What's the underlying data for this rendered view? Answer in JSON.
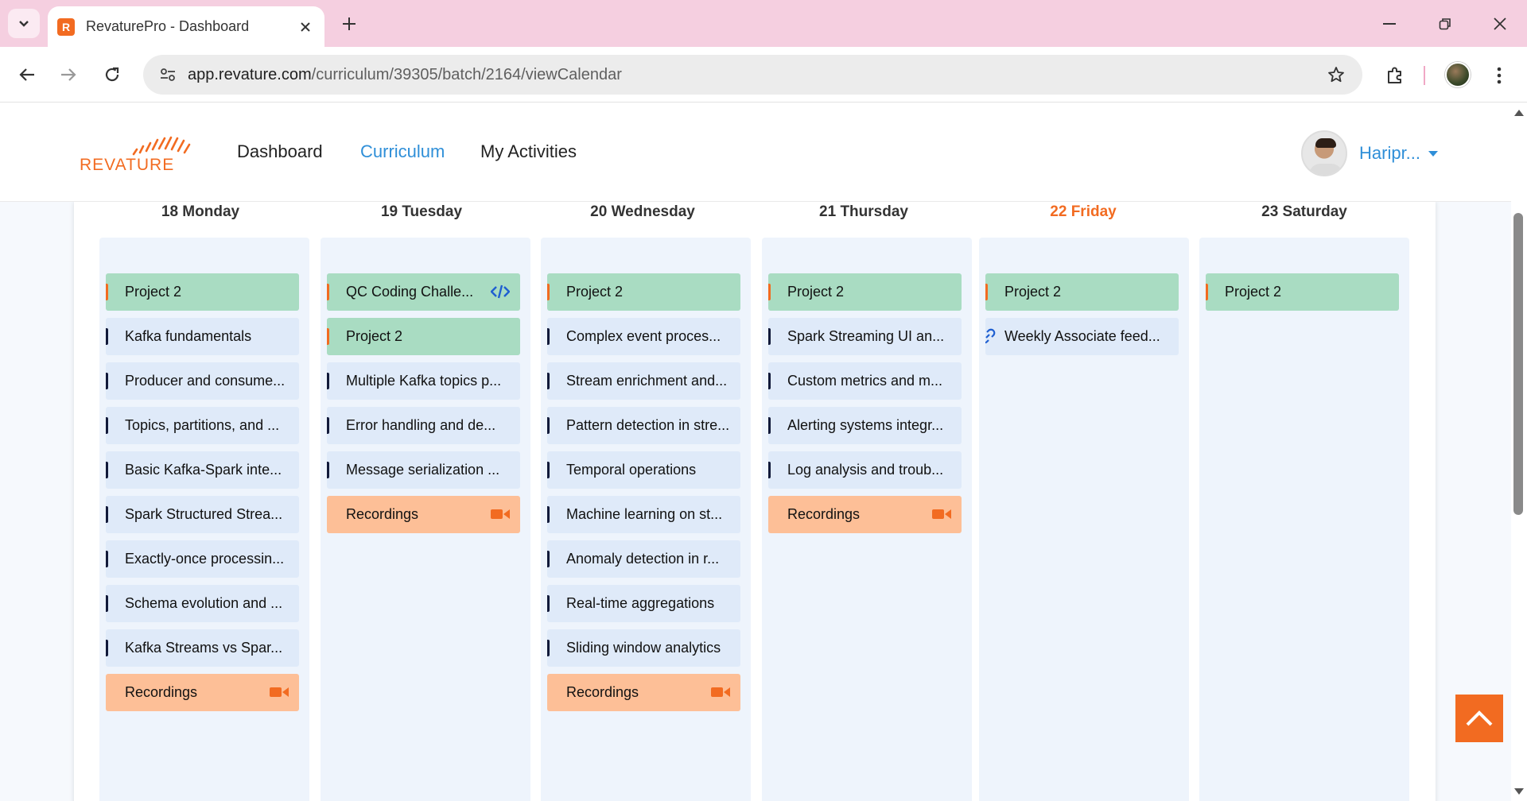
{
  "browser": {
    "tab_title": "RevaturePro - Dashboard",
    "favicon_letter": "R",
    "url_host": "app.revature.com",
    "url_path": "/curriculum/39305/batch/2164/viewCalendar"
  },
  "header": {
    "logo_text": "REVATURE",
    "nav": [
      "Dashboard",
      "Curriculum",
      "My Activities"
    ],
    "active_nav": "Curriculum",
    "username": "Haripr..."
  },
  "colors": {
    "accent": "#f26b21",
    "link": "#2f8fd8",
    "project": "#a9dcc2",
    "recording": "#fdbf97",
    "topic": "#dfeaf9"
  },
  "days": [
    {
      "label": "18 Monday",
      "today": false,
      "items": [
        {
          "type": "project",
          "label": "Project 2"
        },
        {
          "type": "topic",
          "label": "Kafka fundamentals"
        },
        {
          "type": "topic",
          "label": "Producer and consume..."
        },
        {
          "type": "topic",
          "label": "Topics, partitions, and ..."
        },
        {
          "type": "topic",
          "label": "Basic Kafka-Spark inte..."
        },
        {
          "type": "topic",
          "label": "Spark Structured Strea..."
        },
        {
          "type": "topic",
          "label": "Exactly-once processin..."
        },
        {
          "type": "topic",
          "label": "Schema evolution and ..."
        },
        {
          "type": "topic",
          "label": "Kafka Streams vs Spar..."
        },
        {
          "type": "recording",
          "label": "Recordings",
          "icon": "video-camera-icon"
        }
      ]
    },
    {
      "label": "19 Tuesday",
      "today": false,
      "items": [
        {
          "type": "project",
          "label": "QC Coding Challe...",
          "icon": "code-icon"
        },
        {
          "type": "project",
          "label": "Project 2"
        },
        {
          "type": "topic",
          "label": "Multiple Kafka topics p..."
        },
        {
          "type": "topic",
          "label": "Error handling and de..."
        },
        {
          "type": "topic",
          "label": "Message serialization ..."
        },
        {
          "type": "recording",
          "label": "Recordings",
          "icon": "video-camera-icon"
        }
      ]
    },
    {
      "label": "20 Wednesday",
      "today": false,
      "items": [
        {
          "type": "project",
          "label": "Project 2"
        },
        {
          "type": "topic",
          "label": "Complex event proces..."
        },
        {
          "type": "topic",
          "label": "Stream enrichment and..."
        },
        {
          "type": "topic",
          "label": "Pattern detection in stre..."
        },
        {
          "type": "topic",
          "label": "Temporal operations"
        },
        {
          "type": "topic",
          "label": "Machine learning on st..."
        },
        {
          "type": "topic",
          "label": "Anomaly detection in r..."
        },
        {
          "type": "topic",
          "label": "Real-time aggregations"
        },
        {
          "type": "topic",
          "label": "Sliding window analytics"
        },
        {
          "type": "recording",
          "label": "Recordings",
          "icon": "video-camera-icon"
        }
      ]
    },
    {
      "label": "21 Thursday",
      "today": false,
      "items": [
        {
          "type": "project",
          "label": "Project 2"
        },
        {
          "type": "topic",
          "label": "Spark Streaming UI an..."
        },
        {
          "type": "topic",
          "label": "Custom metrics and m..."
        },
        {
          "type": "topic",
          "label": "Alerting systems integr..."
        },
        {
          "type": "topic",
          "label": "Log analysis and troub..."
        },
        {
          "type": "recording",
          "label": "Recordings",
          "icon": "video-camera-icon"
        }
      ]
    },
    {
      "label": "22 Friday",
      "today": true,
      "items": [
        {
          "type": "project",
          "label": "Project 2"
        },
        {
          "type": "link",
          "label": "Weekly Associate feed...",
          "icon": "link-icon"
        }
      ]
    },
    {
      "label": "23 Saturday",
      "today": false,
      "items": [
        {
          "type": "project",
          "label": "Project 2"
        }
      ]
    }
  ]
}
